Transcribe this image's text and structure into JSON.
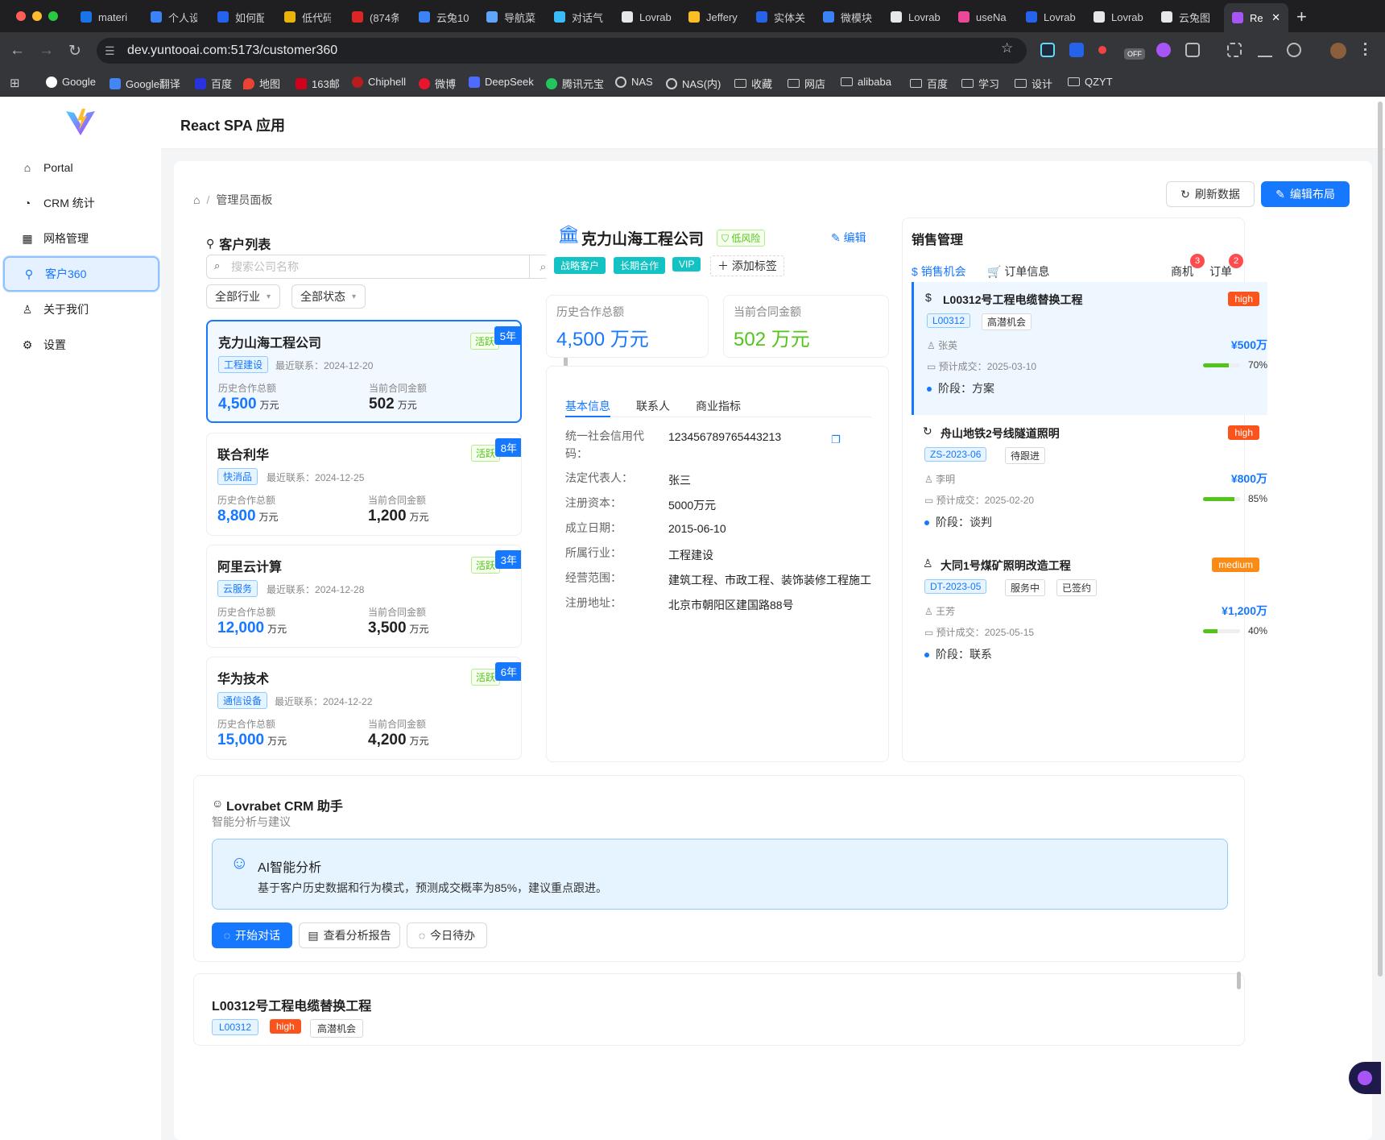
{
  "browser": {
    "tabs": [
      "materi",
      "个人设",
      "如何配",
      "低代码",
      "(874条",
      "云兔10",
      "导航菜",
      "对话气",
      "Lovrab",
      "Jeffery",
      "实体关",
      "微模块",
      "Lovrab",
      "useNa",
      "Lovrab",
      "Lovrab",
      "云兔图",
      "Re"
    ],
    "url": "dev.yuntooai.com:5173/customer360",
    "ext_off_label": "OFF",
    "bookmarks": [
      "Google",
      "Google翻译",
      "百度",
      "地图",
      "163邮",
      "Chiphell",
      "微博",
      "DeepSeek",
      "腾讯元宝",
      "NAS",
      "NAS(内)",
      "收藏",
      "网店",
      "alibaba",
      "百度",
      "学习",
      "设计",
      "QZYT"
    ]
  },
  "app": {
    "header_title": "React SPA 应用",
    "menu": [
      {
        "label": "Portal",
        "icon": "home-icon"
      },
      {
        "label": "CRM 统计",
        "icon": "dashboard-icon"
      },
      {
        "label": "网格管理",
        "icon": "table-icon"
      },
      {
        "label": "客户360",
        "icon": "user-search-icon"
      },
      {
        "label": "关于我们",
        "icon": "user-icon"
      },
      {
        "label": "设置",
        "icon": "gear-icon"
      }
    ],
    "active_menu": "客户360"
  },
  "page": {
    "breadcrumb": "管理员面板",
    "refresh_label": "刷新数据",
    "edit_layout_label": "编辑布局"
  },
  "customer_list": {
    "title": "客户列表",
    "search_placeholder": "搜索公司名称",
    "filter_industry": "全部行业",
    "filter_status": "全部状态",
    "hist_label": "历史合作总额",
    "cur_label": "当前合同金额",
    "unit": "万元",
    "last_contact_prefix": "最近联系：",
    "items": [
      {
        "name": "克力山海工程公司",
        "industry": "工程建设",
        "last_contact": "2024-12-20",
        "hist": "4,500",
        "current": "502",
        "status": "活跃",
        "years": "5年"
      },
      {
        "name": "联合利华",
        "industry": "快消品",
        "last_contact": "2024-12-25",
        "hist": "8,800",
        "current": "1,200",
        "status": "活跃",
        "years": "8年"
      },
      {
        "name": "阿里云计算",
        "industry": "云服务",
        "last_contact": "2024-12-28",
        "hist": "12,000",
        "current": "3,500",
        "status": "活跃",
        "years": "3年"
      },
      {
        "name": "华为技术",
        "industry": "通信设备",
        "last_contact": "2024-12-22",
        "hist": "15,000",
        "current": "4,200",
        "status": "活跃",
        "years": "6年"
      }
    ]
  },
  "detail": {
    "company": "克力山海工程公司",
    "risk": "低风险",
    "edit_label": "编辑",
    "tags": [
      "战略客户",
      "长期合作",
      "VIP"
    ],
    "add_tag_label": "添加标签",
    "hist_label": "历史合作总额",
    "hist_value": "4,500 万元",
    "cur_label": "当前合同金额",
    "cur_value": "502 万元",
    "tabs": [
      "基本信息",
      "联系人",
      "商业指标"
    ],
    "info": [
      {
        "label": "统一社会信用代码：",
        "value": "123456789765443213"
      },
      {
        "label": "法定代表人：",
        "value": "张三"
      },
      {
        "label": "注册资本：",
        "value": "5000万元"
      },
      {
        "label": "成立日期：",
        "value": "2015-06-10"
      },
      {
        "label": "所属行业：",
        "value": "工程建设"
      },
      {
        "label": "经营范围：",
        "value": "建筑工程、市政工程、装饰装修工程施工"
      },
      {
        "label": "注册地址：",
        "value": "北京市朝阳区建国路88号"
      }
    ]
  },
  "sales": {
    "title": "销售管理",
    "tab_opps": "销售机会",
    "tab_orders": "订单信息",
    "right_tab_1": "商机",
    "right_tab_1_badge": "3",
    "right_tab_2": "订单",
    "right_tab_2_badge": "2",
    "stage_prefix": "阶段：",
    "eta_prefix": "预计成交：",
    "opps": [
      {
        "title": "L00312号工程电缆替换工程",
        "priority": "high",
        "priority_color": "#fa541c",
        "code": "L00312",
        "tags": [
          "高潜机会"
        ],
        "owner": "张英",
        "amount": "¥500万",
        "eta": "2025-03-10",
        "progress": 0.7,
        "progress_text": "70%",
        "stage": "方案",
        "icon": "dollar-icon"
      },
      {
        "title": "舟山地铁2号线隧道照明",
        "priority": "high",
        "priority_color": "#fa541c",
        "code": "ZS-2023-06",
        "tags": [
          "待跟进"
        ],
        "owner": "李明",
        "amount": "¥800万",
        "eta": "2025-02-20",
        "progress": 0.85,
        "progress_text": "85%",
        "stage": "谈判",
        "icon": "sync-icon"
      },
      {
        "title": "大同1号煤矿照明改造工程",
        "priority": "medium",
        "priority_color": "#fa8c16",
        "code": "DT-2023-05",
        "tags": [
          "服务中",
          "已签约"
        ],
        "owner": "王芳",
        "amount": "¥1,200万",
        "eta": "2025-05-15",
        "progress": 0.4,
        "progress_text": "40%",
        "stage": "联系",
        "icon": "user-icon"
      }
    ]
  },
  "assistant": {
    "title": "Lovrabet CRM 助手",
    "subtitle": "智能分析与建议",
    "ai_title": "AI智能分析",
    "ai_text": "基于客户历史数据和行为模式，预测成交概率为85%，建议重点跟进。",
    "btn_chat": "开始对话",
    "btn_report": "查看分析报告",
    "btn_todo": "今日待办"
  },
  "bottom_card": {
    "title": "L00312号工程电缆替换工程",
    "code": "L00312",
    "priority": "high",
    "tag": "高潜机会"
  }
}
